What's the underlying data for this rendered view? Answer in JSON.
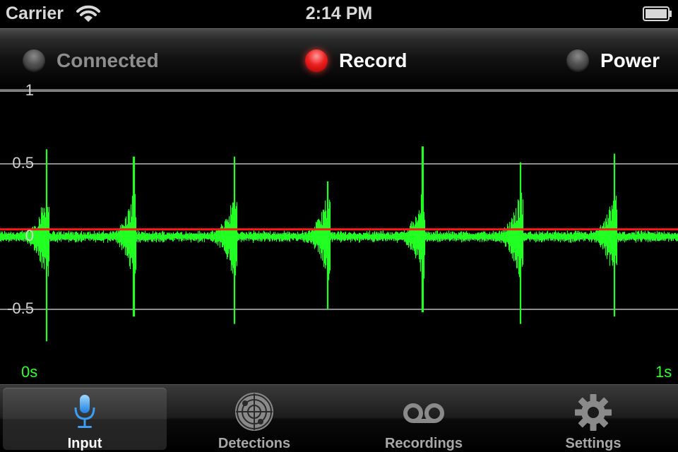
{
  "status_bar": {
    "carrier": "Carrier",
    "time": "2:14 PM",
    "wifi_icon": "wifi-icon",
    "battery_icon": "battery-full-icon"
  },
  "indicators": [
    {
      "label": "Connected",
      "state": "off"
    },
    {
      "label": "Record",
      "state": "on"
    },
    {
      "label": "Power",
      "state": "off"
    }
  ],
  "waveform": {
    "y_ticks": [
      "1",
      "0.5",
      "0",
      "-0.5"
    ],
    "x_start_label": "0s",
    "x_end_label": "1s",
    "threshold_value": 0.05,
    "y_range": [
      -0.85,
      1.0
    ],
    "time_range_s": [
      0,
      1
    ],
    "pulses": [
      {
        "t": 0.068,
        "max": 0.6,
        "min": -0.72
      },
      {
        "t": 0.197,
        "max": 0.55,
        "min": -0.55
      },
      {
        "t": 0.345,
        "max": 0.55,
        "min": -0.6
      },
      {
        "t": 0.483,
        "max": 0.38,
        "min": -0.5
      },
      {
        "t": 0.623,
        "max": 0.62,
        "min": -0.52
      },
      {
        "t": 0.767,
        "max": 0.51,
        "min": -0.6
      },
      {
        "t": 0.906,
        "max": 0.57,
        "min": -0.55
      }
    ],
    "colors": {
      "signal": "#22ff22",
      "threshold": "#ff1a1a",
      "gridline": "#8c8c8c"
    }
  },
  "tabs": [
    {
      "label": "Input",
      "icon": "microphone-icon",
      "selected": true
    },
    {
      "label": "Detections",
      "icon": "radar-icon",
      "selected": false
    },
    {
      "label": "Recordings",
      "icon": "voicemail-icon",
      "selected": false
    },
    {
      "label": "Settings",
      "icon": "gear-icon",
      "selected": false
    }
  ]
}
